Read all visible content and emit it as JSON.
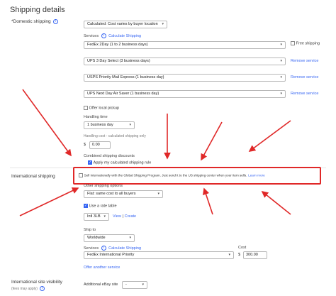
{
  "section_title": "Shipping details",
  "domestic": {
    "label": "*Domestic shipping",
    "calc_option": "Calculated: Cost varies by buyer location",
    "services_label": "Services",
    "calc_link": "Calculate Shipping",
    "services": [
      {
        "name": "FedEx 2Day (1 to 2 business days)",
        "action": "Free shipping"
      },
      {
        "name": "UPS 3 Day Select (3 business days)",
        "action": "Remove service"
      },
      {
        "name": "USPS Priority Mail Express (1 business day)",
        "action": "Remove service"
      },
      {
        "name": "UPS Next Day Air Saver (1 business day)",
        "action": "Remove service"
      }
    ],
    "local_pickup": "Offer local pickup",
    "handling_label": "Handling time",
    "handling_value": "1 business day",
    "handling_cost_label": "Handling cost - calculated shipping only",
    "currency": "$",
    "handling_cost_value": "0.00",
    "combined_label": "Combined shipping discounts",
    "combined_rule": "Apply my calculated shipping rule"
  },
  "international": {
    "label": "International shipping",
    "gsp_text": "Sell internationally with the Global Shipping Program. Just send it to the US shipping center when your item sells.",
    "learn_more": "Learn more",
    "other_label": "Other shipping options",
    "other_value": "Flat: same cost to all buyers",
    "rate_table": "Use a rate table",
    "rate_select": "Intl 3LB",
    "view_link": "View",
    "sep": "|",
    "create_link": "Create",
    "ship_to_label": "Ship to",
    "ship_to_value": "Worldwide",
    "services_label": "Services",
    "calc_link": "Calculate Shipping",
    "cost_label": "Cost",
    "service_value": "FedEx International Priority",
    "currency": "$",
    "cost_value": "300.00",
    "offer_another": "Offer another service"
  },
  "site_visibility": {
    "label": "International site visibility",
    "sub": "(fees may apply)",
    "additional_label": "Additional eBay site",
    "additional_value": "-"
  },
  "colors": {
    "link": "#3665f3",
    "highlight": "#e02828"
  }
}
